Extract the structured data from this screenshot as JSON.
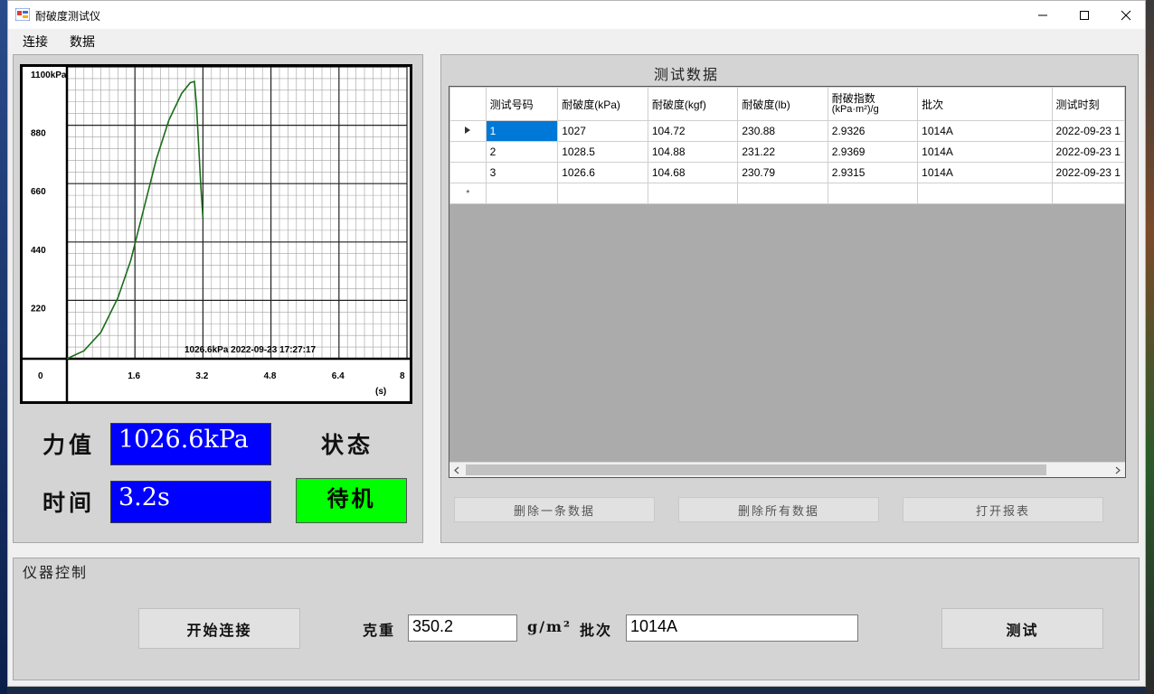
{
  "window": {
    "title": "耐破度测试仪"
  },
  "menu": [
    "连接",
    "数据"
  ],
  "chart_data": {
    "type": "line",
    "ylim": [
      0,
      1100
    ],
    "xlim": [
      0,
      8
    ],
    "y_ticks": [
      "1100kPa",
      "880",
      "660",
      "440",
      "220"
    ],
    "x_ticks": [
      "0",
      "1.6",
      "3.2",
      "4.8",
      "6.4",
      "8"
    ],
    "x_unit": "(s)",
    "annotation": "1026.6kPa  2022-09-23 17:27:17",
    "series": [
      {
        "color": "#1a6e1a",
        "x": [
          0,
          0.4,
          0.8,
          1.2,
          1.5,
          1.8,
          2.1,
          2.4,
          2.7,
          2.9,
          3.0,
          3.05,
          3.1,
          3.15,
          3.2
        ],
        "y": [
          0,
          30,
          100,
          230,
          370,
          560,
          750,
          900,
          1000,
          1040,
          1045,
          950,
          800,
          650,
          530
        ]
      }
    ]
  },
  "readout": {
    "force_label": "力值",
    "force_value": "1026.6kPa",
    "time_label": "时间",
    "time_value": "3.2s",
    "status_label": "状态",
    "status_value": "待机"
  },
  "grid": {
    "title": "测试数据",
    "columns": [
      "测试号码",
      "耐破度(kPa)",
      "耐破度(kgf)",
      "耐破度(lb)",
      "耐破指数",
      "批次",
      "测试时刻"
    ],
    "index_unit": "(kPa·m²)/g",
    "rows": [
      [
        "1",
        "1027",
        "104.72",
        "230.88",
        "2.9326",
        "1014A",
        "2022-09-23 1"
      ],
      [
        "2",
        "1028.5",
        "104.88",
        "231.22",
        "2.9369",
        "1014A",
        "2022-09-23 1"
      ],
      [
        "3",
        "1026.6",
        "104.68",
        "230.79",
        "2.9315",
        "1014A",
        "2022-09-23 1"
      ]
    ],
    "new_row_marker": "*",
    "buttons": {
      "delete_one": "删除一条数据",
      "delete_all": "删除所有数据",
      "open_report": "打开报表"
    }
  },
  "control": {
    "title": "仪器控制",
    "connect_button": "开始连接",
    "weight_label": "克重",
    "weight_value": "350.2",
    "weight_unit": "g/m²",
    "batch_label": "批次",
    "batch_value": "1014A",
    "test_button": "测试"
  }
}
